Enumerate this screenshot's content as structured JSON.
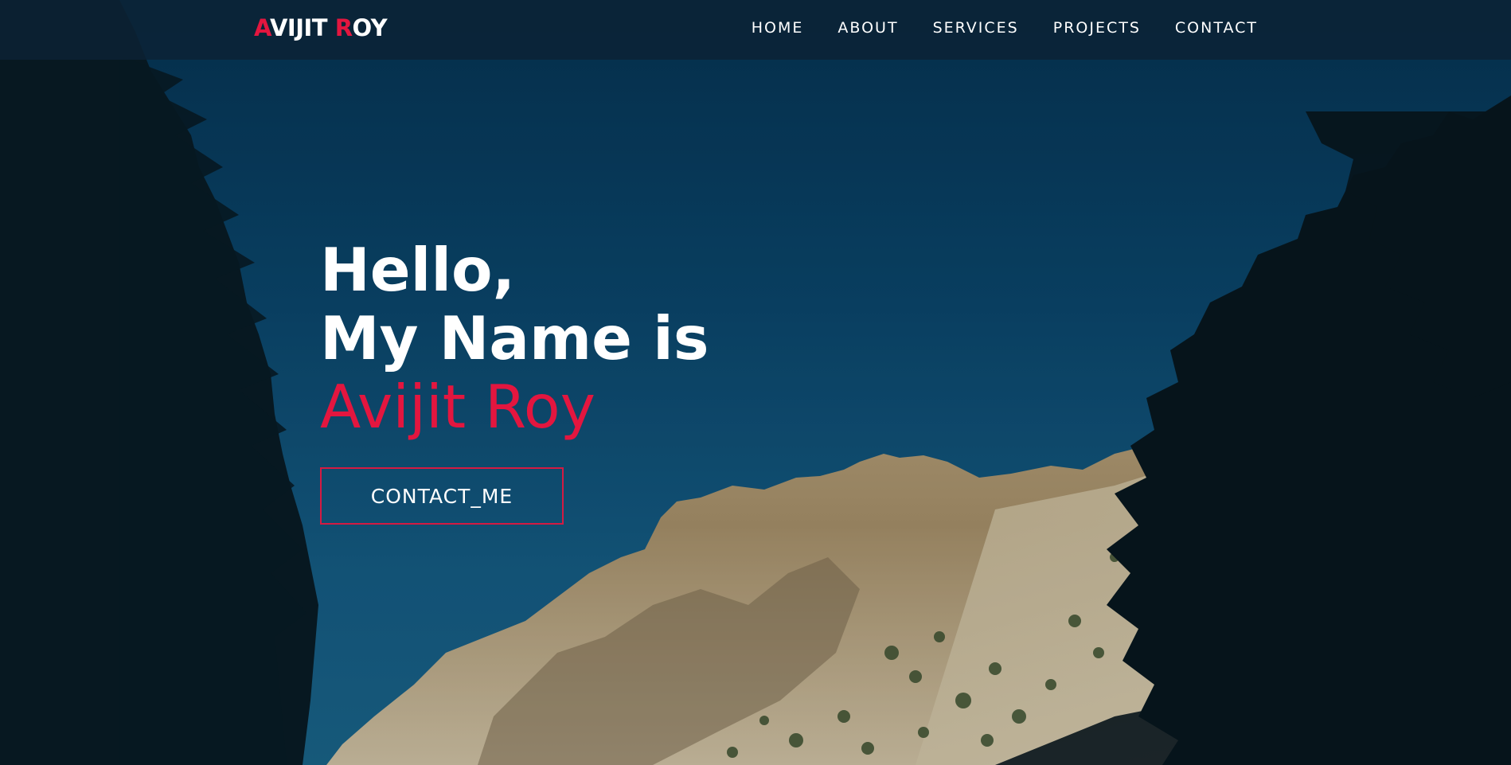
{
  "brand": {
    "logo_first_initial": "A",
    "logo_first_rest": "VIJIT ",
    "logo_last_initial": "R",
    "logo_last_rest": "OY",
    "accent_color": "#e3163f"
  },
  "nav": {
    "items": [
      {
        "label": "HOME"
      },
      {
        "label": "ABOUT"
      },
      {
        "label": "SERVICES"
      },
      {
        "label": "PROJECTS"
      },
      {
        "label": "CONTACT"
      }
    ]
  },
  "hero": {
    "greeting": "Hello,",
    "intro": "My Name is",
    "name": "Avijit Roy",
    "cta_label": "CONTACT_ME"
  },
  "background": {
    "description_colors": {
      "sky_top": "#05314f",
      "sky_bottom": "#1a6285",
      "rock": "#b59d77",
      "trees": "#0a1820"
    }
  }
}
